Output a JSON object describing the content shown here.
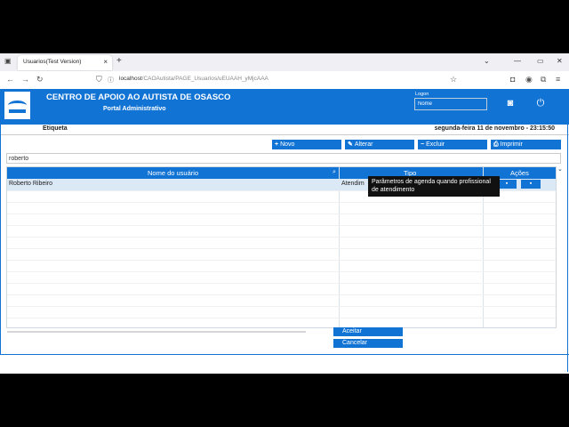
{
  "browser": {
    "tab_title": "Usuarios(Test Version)",
    "tab_close": "×",
    "new_tab": "+",
    "url_host": "localhost",
    "url_path": "/CAOAutista/PAGE_Usuarios/uEUAAH_yMjcAAA",
    "icons": [
      "tab-list-icon",
      "back-arrow-icon",
      "forward-arrow-icon",
      "reload-icon",
      "shield-icon",
      "star-icon",
      "pocket-icon",
      "account-icon",
      "extensions-icon",
      "menu-icon",
      "minimize-icon",
      "maximize-icon",
      "close-icon"
    ]
  },
  "header": {
    "title": "CENTRO DE APOIO AO AUTISTA DE OSASCO",
    "subtitle": "Portal Administrativo",
    "login_label": "Logon",
    "login_value": "Nome",
    "brand_color": "#1173d4"
  },
  "infobar": {
    "etiqueta": "Etiqueta",
    "datetime": "segunda-feira 11 de novembro - 23:15:50"
  },
  "toolbar": {
    "novo": "Novo",
    "alterar": "Alterar",
    "excluir": "Excluir",
    "imprimir": "Imprimir"
  },
  "search": {
    "value": "roberto"
  },
  "grid": {
    "columns": [
      "Nome do usuário",
      "Tipo",
      "Ações"
    ],
    "rows": [
      {
        "nome": "Roberto Ribeiro",
        "tipo": "Atendim"
      }
    ],
    "tooltip": "Parâmetros de agenda quando profissional de atendimento"
  },
  "footer": {
    "aceitar": "Aceitar",
    "cancelar": "Cancelar"
  }
}
